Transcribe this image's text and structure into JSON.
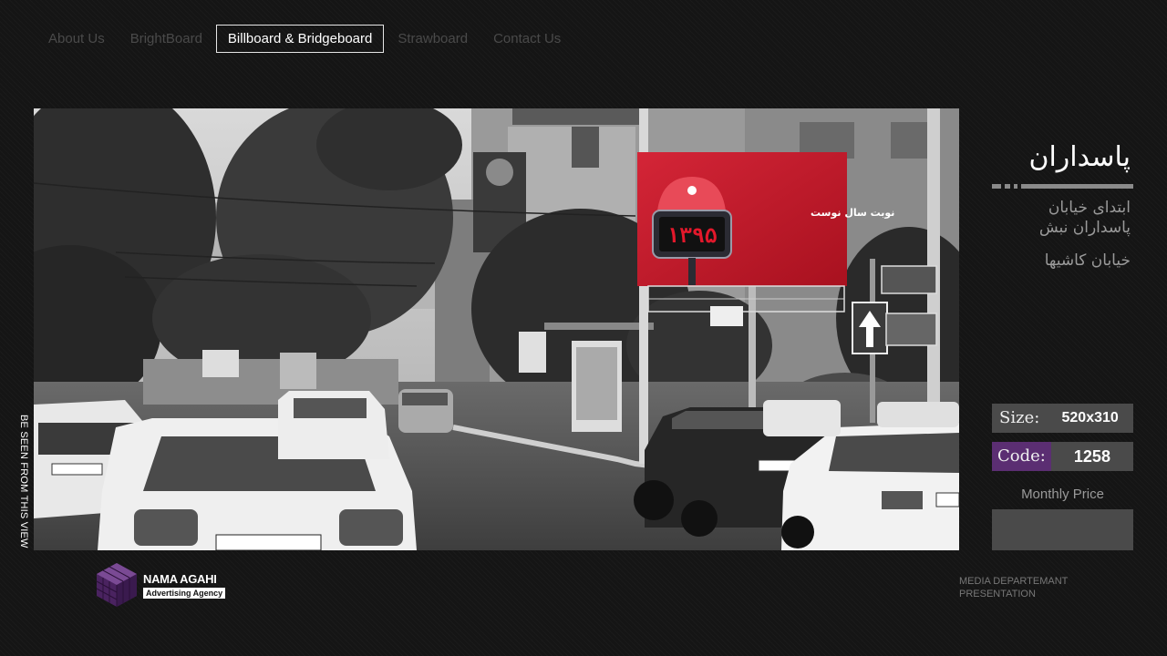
{
  "nav": {
    "items": [
      {
        "label": "About Us",
        "active": false
      },
      {
        "label": "BrightBoard",
        "active": false
      },
      {
        "label": "Billboard & Bridgeboard",
        "active": true
      },
      {
        "label": "Strawboard",
        "active": false
      },
      {
        "label": "Contact Us",
        "active": false
      }
    ]
  },
  "side_label": "BE SEEN FROM THIS VIEW",
  "photo": {
    "billboard_text": "نوبت سال نوست",
    "billboard_counter": "۱۳۹۵",
    "accent_color": "#c81e2e"
  },
  "info": {
    "title": "پاسداران",
    "address_line1": "ابتدای خیابان پاسداران نبش",
    "address_line2": "خیابان کاشیها",
    "size_label": "Size:",
    "size_value": "520x310",
    "code_label": "Code:",
    "code_value": "1258",
    "price_label": "Monthly Price",
    "price_value": ""
  },
  "footer": {
    "logo_name": "NAMA AGAHI",
    "logo_sub": "Advertising Agency",
    "dept_line1": "MEDIA DEPARTEMANT",
    "dept_line2": "PRESENTATION"
  },
  "colors": {
    "background": "#151515",
    "code_accent": "#5b2e72",
    "box": "#4a4a4a",
    "logo": "#5b2e72"
  }
}
